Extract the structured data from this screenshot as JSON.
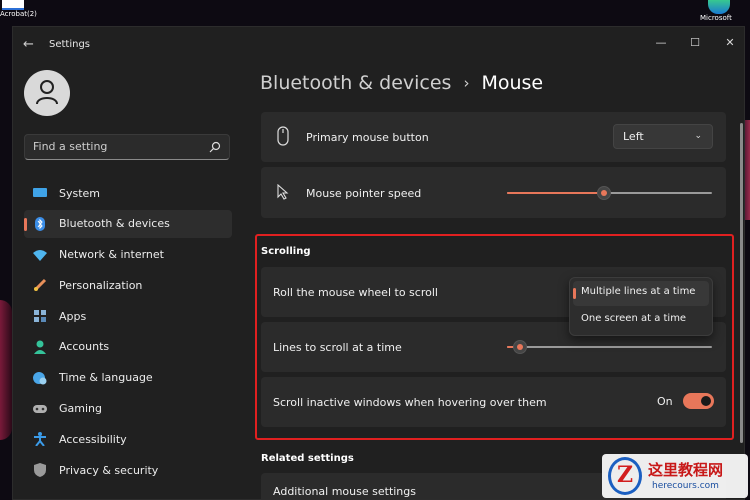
{
  "desktop": {
    "left_icon_label": "Acrobat(2)",
    "right_icon_label": "Microsoft"
  },
  "window": {
    "title": "Settings",
    "controls": [
      "—",
      "☐",
      "✕"
    ]
  },
  "search": {
    "placeholder": "Find a setting"
  },
  "sidebar": {
    "items": [
      {
        "label": "System",
        "icon": "monitor-icon",
        "color": "#3fa3e8"
      },
      {
        "label": "Bluetooth & devices",
        "icon": "bluetooth-icon",
        "color": "#3b8ee8",
        "active": true
      },
      {
        "label": "Network & internet",
        "icon": "wifi-icon",
        "color": "#4fb6ef"
      },
      {
        "label": "Personalization",
        "icon": "brush-icon",
        "color": "#e8905a"
      },
      {
        "label": "Apps",
        "icon": "apps-icon",
        "color": "#8ab4d8"
      },
      {
        "label": "Accounts",
        "icon": "person-icon",
        "color": "#34c39a"
      },
      {
        "label": "Time & language",
        "icon": "globe-clock-icon",
        "color": "#4aa6e8"
      },
      {
        "label": "Gaming",
        "icon": "gamepad-icon",
        "color": "#b0b0b0"
      },
      {
        "label": "Accessibility",
        "icon": "accessibility-icon",
        "color": "#3b9be8"
      },
      {
        "label": "Privacy & security",
        "icon": "shield-icon",
        "color": "#9a9a9a"
      }
    ]
  },
  "breadcrumb": {
    "parent": "Bluetooth & devices",
    "separator": "›",
    "current": "Mouse"
  },
  "primary_button": {
    "label": "Primary mouse button",
    "value": "Left",
    "chevron": "⌄"
  },
  "pointer_speed": {
    "label": "Mouse pointer speed",
    "level": 0.47
  },
  "scrolling": {
    "section_title": "Scrolling",
    "roll_label": "Roll the mouse wheel to scroll",
    "roll_options": [
      "Multiple lines at a time",
      "One screen at a time"
    ],
    "roll_selected": "Multiple lines at a time",
    "lines_label": "Lines to scroll at a time",
    "lines_level": 0.03,
    "inactive_label": "Scroll inactive windows when hovering over them",
    "inactive_state": "On"
  },
  "related": {
    "title": "Related settings",
    "first_item": "Additional mouse settings"
  },
  "colors": {
    "accent": "#e8775a",
    "highlight": "#e02020",
    "background": "#202020",
    "card": "#2b2b2b"
  },
  "watermark": {
    "logo_letter": "Z",
    "title": "这里教程网",
    "url": "herecours.com"
  }
}
